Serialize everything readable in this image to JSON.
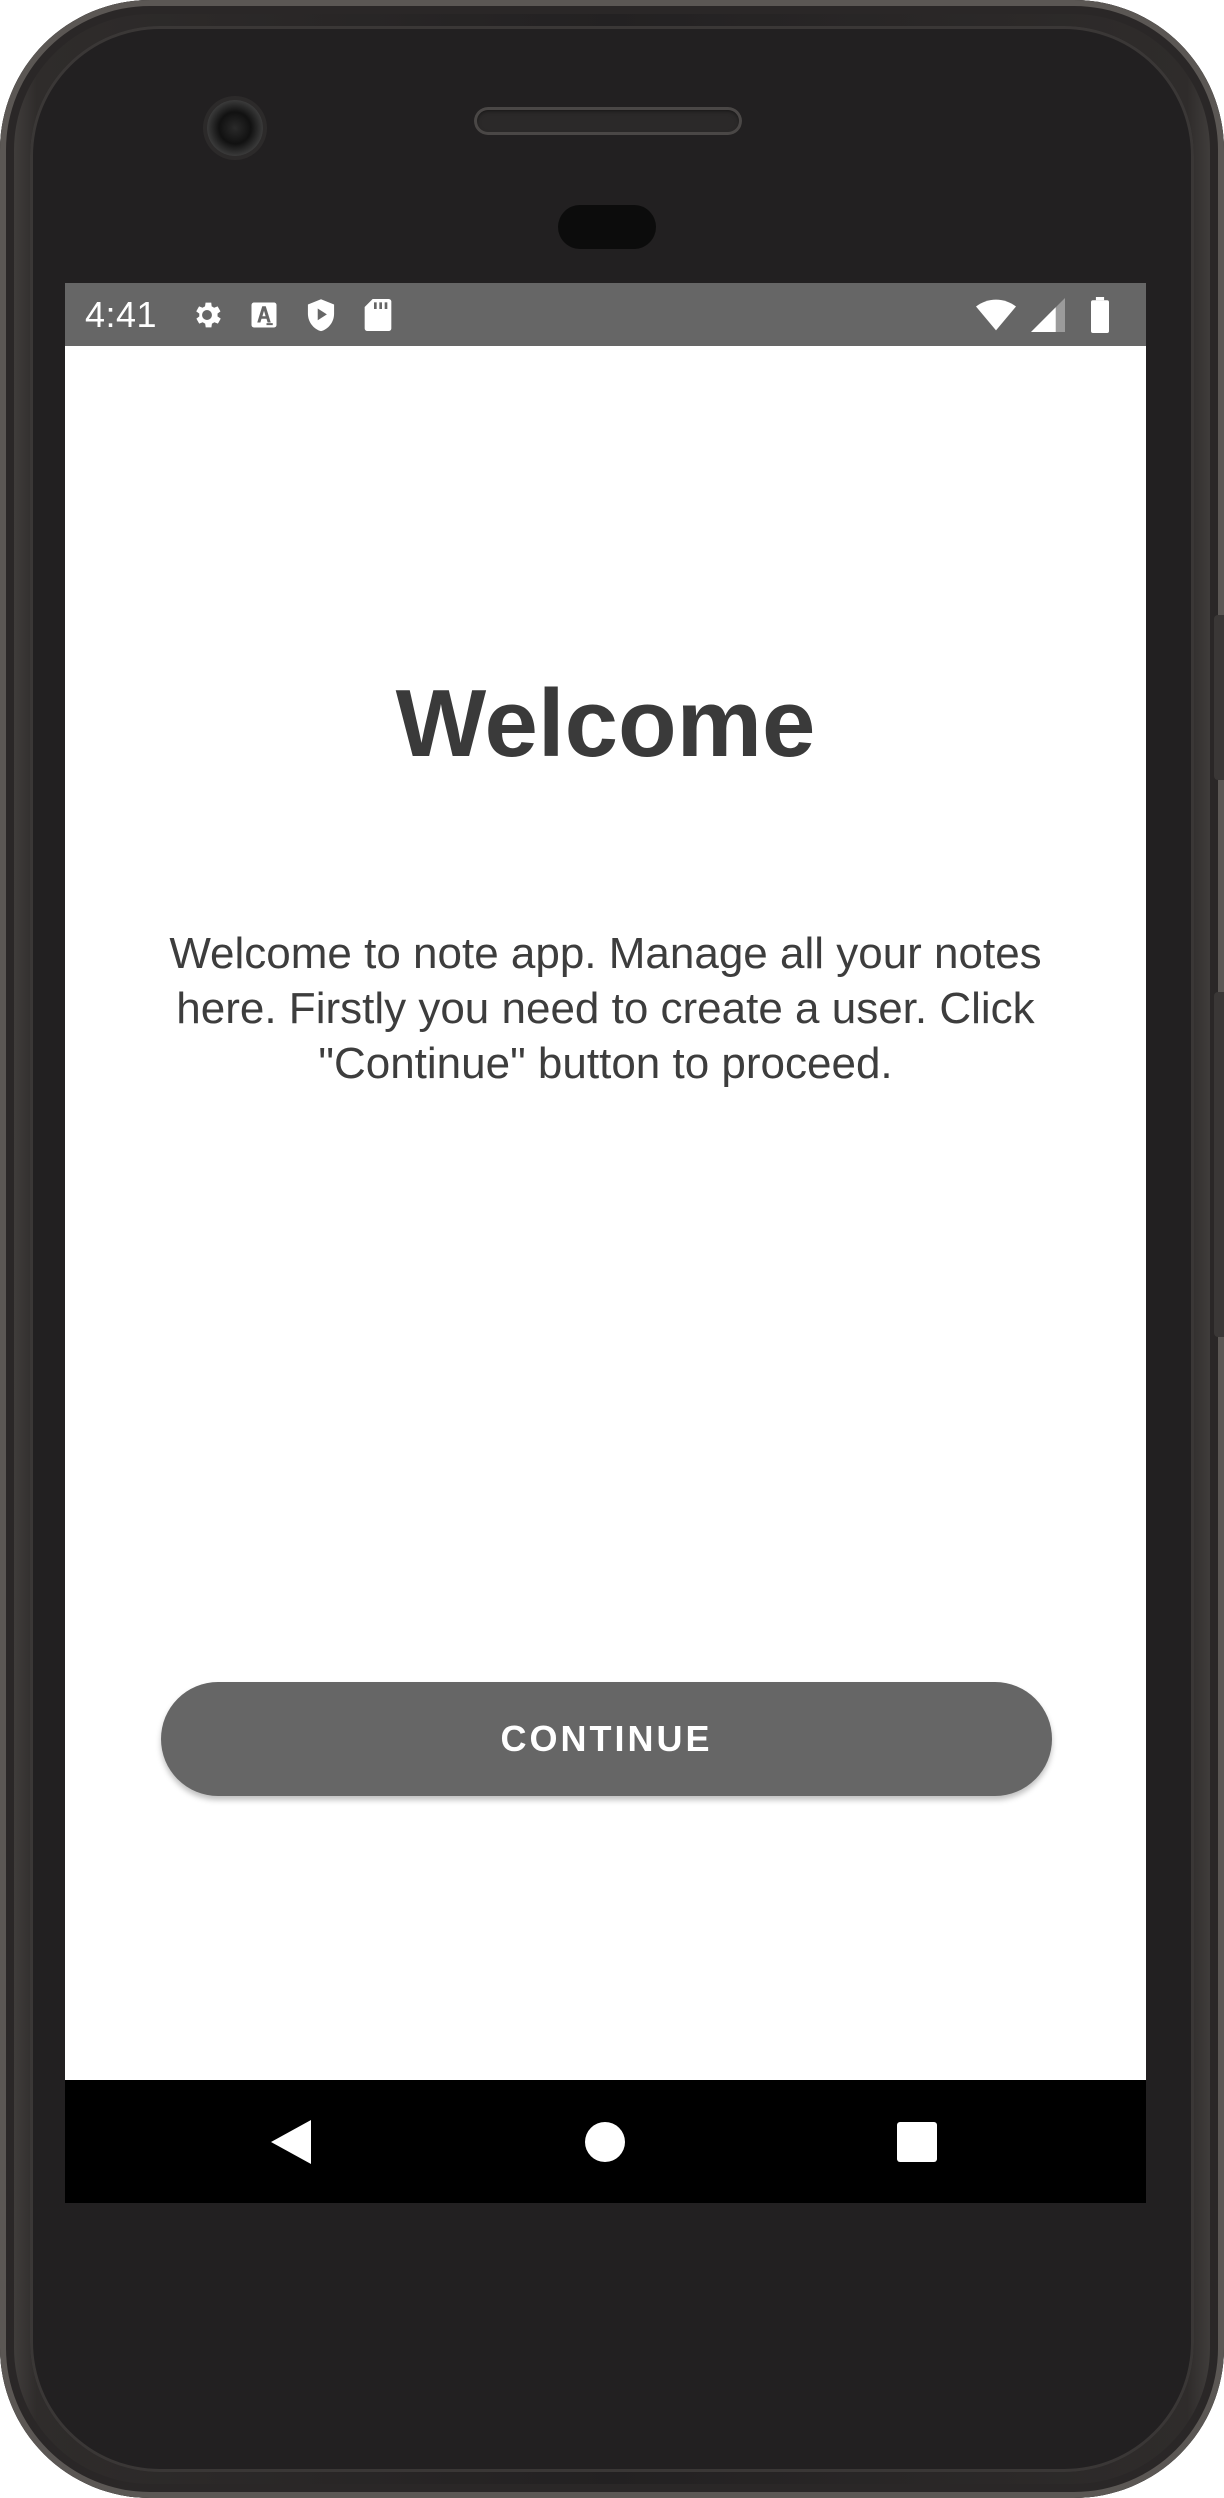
{
  "status_bar": {
    "time": "4:41",
    "left_icons": [
      "gear-icon",
      "font-a-icon",
      "shield-play-icon",
      "sd-card-icon"
    ],
    "right_icons": [
      "wifi-icon",
      "cell-signal-icon",
      "battery-icon"
    ]
  },
  "welcome": {
    "title": "Welcome",
    "description": "Welcome to note app. Manage all your notes here. Firstly you need to create a user. Click \"Continue\" button to proceed."
  },
  "actions": {
    "continue_label": "CONTINUE"
  },
  "nav_bar": {
    "buttons": [
      "back-icon",
      "home-icon",
      "recents-icon"
    ]
  },
  "colors": {
    "status_bar": "#666666",
    "button": "#666666",
    "title_text": "#3a3a3a",
    "nav_bar": "#000000",
    "screen_bg": "#ffffff"
  }
}
